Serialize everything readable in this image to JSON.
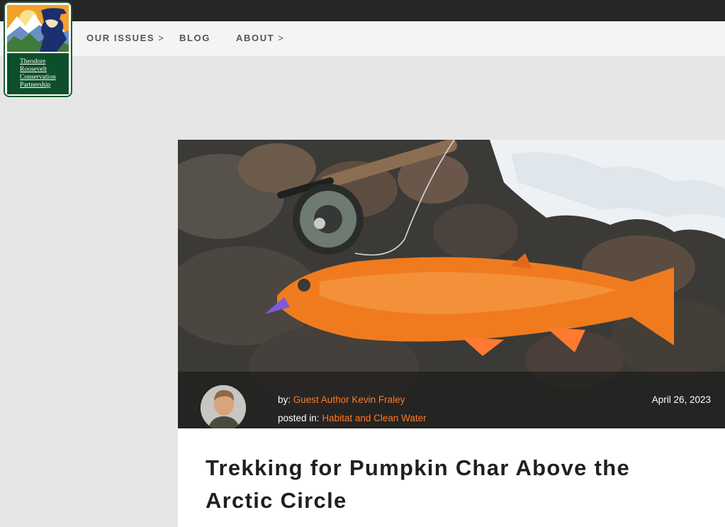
{
  "logo": {
    "text_lines": [
      "Theodore",
      "Roosevelt",
      "Conservation",
      "Partnership"
    ],
    "icon": "trcp-logo-icon"
  },
  "nav": {
    "items": [
      {
        "label": "OUR ISSUES",
        "caret": ">"
      },
      {
        "label": "BLOG",
        "caret": ""
      },
      {
        "label": "ABOUT",
        "caret": ">"
      }
    ]
  },
  "article": {
    "hero_image": "arctic-char-on-rocks-image",
    "author_prefix": "by:",
    "author": "Guest Author Kevin Fraley",
    "category_prefix": "posted in:",
    "category": "Habitat and Clean Water",
    "date": "April 26, 2023",
    "title": "Trekking for Pumpkin Char Above the Arctic Circle"
  },
  "colors": {
    "accent_link": "#ff7a22",
    "top_bar": "#262626",
    "nav_bg": "#f4f4f4",
    "logo_green": "#0e4f2b"
  }
}
